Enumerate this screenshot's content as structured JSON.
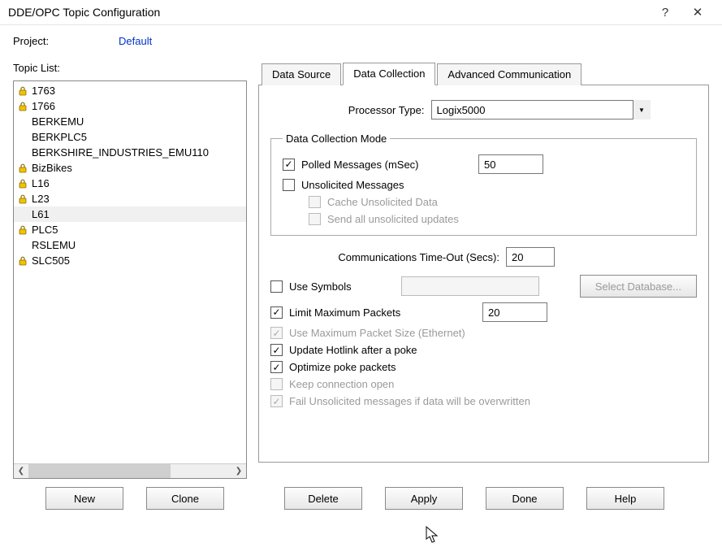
{
  "window": {
    "title": "DDE/OPC Topic Configuration"
  },
  "project": {
    "label": "Project:",
    "value": "Default"
  },
  "topic_list": {
    "label": "Topic List:",
    "items": [
      {
        "label": "1763",
        "locked": true,
        "selected": false
      },
      {
        "label": "1766",
        "locked": true,
        "selected": false
      },
      {
        "label": "BERKEMU",
        "locked": false,
        "selected": false
      },
      {
        "label": "BERKPLC5",
        "locked": false,
        "selected": false
      },
      {
        "label": "BERKSHIRE_INDUSTRIES_EMU110",
        "locked": false,
        "selected": false
      },
      {
        "label": "BizBikes",
        "locked": true,
        "selected": false
      },
      {
        "label": "L16",
        "locked": true,
        "selected": false
      },
      {
        "label": "L23",
        "locked": true,
        "selected": false
      },
      {
        "label": "L61",
        "locked": false,
        "selected": true
      },
      {
        "label": "PLC5",
        "locked": true,
        "selected": false
      },
      {
        "label": "RSLEMU",
        "locked": false,
        "selected": false
      },
      {
        "label": "SLC505",
        "locked": true,
        "selected": false
      }
    ]
  },
  "tabs": {
    "data_source": "Data Source",
    "data_collection": "Data Collection",
    "advanced_comm": "Advanced Communication"
  },
  "processor": {
    "label": "Processor Type:",
    "value": "Logix5000"
  },
  "collection_mode": {
    "group_label": "Data Collection Mode",
    "polled_label": "Polled Messages (mSec)",
    "polled_value": "50",
    "unsolicited_label": "Unsolicited Messages",
    "cache_label": "Cache Unsolicited Data",
    "send_all_label": "Send all unsolicited updates"
  },
  "comm_timeout": {
    "label": "Communications Time-Out (Secs):",
    "value": "20"
  },
  "use_symbols": {
    "label": "Use Symbols",
    "value": "",
    "button": "Select Database..."
  },
  "limit_packets": {
    "label": "Limit Maximum Packets",
    "value": "20"
  },
  "max_packet_size": {
    "label": "Use Maximum Packet Size (Ethernet)"
  },
  "update_hotlink": {
    "label": "Update Hotlink after a poke"
  },
  "optimize_poke": {
    "label": "Optimize poke packets"
  },
  "keep_open": {
    "label": "Keep connection open"
  },
  "fail_unsolicited": {
    "label": "Fail Unsolicited messages if data will be overwritten"
  },
  "buttons": {
    "new": "New",
    "clone": "Clone",
    "delete": "Delete",
    "apply": "Apply",
    "done": "Done",
    "help": "Help"
  }
}
